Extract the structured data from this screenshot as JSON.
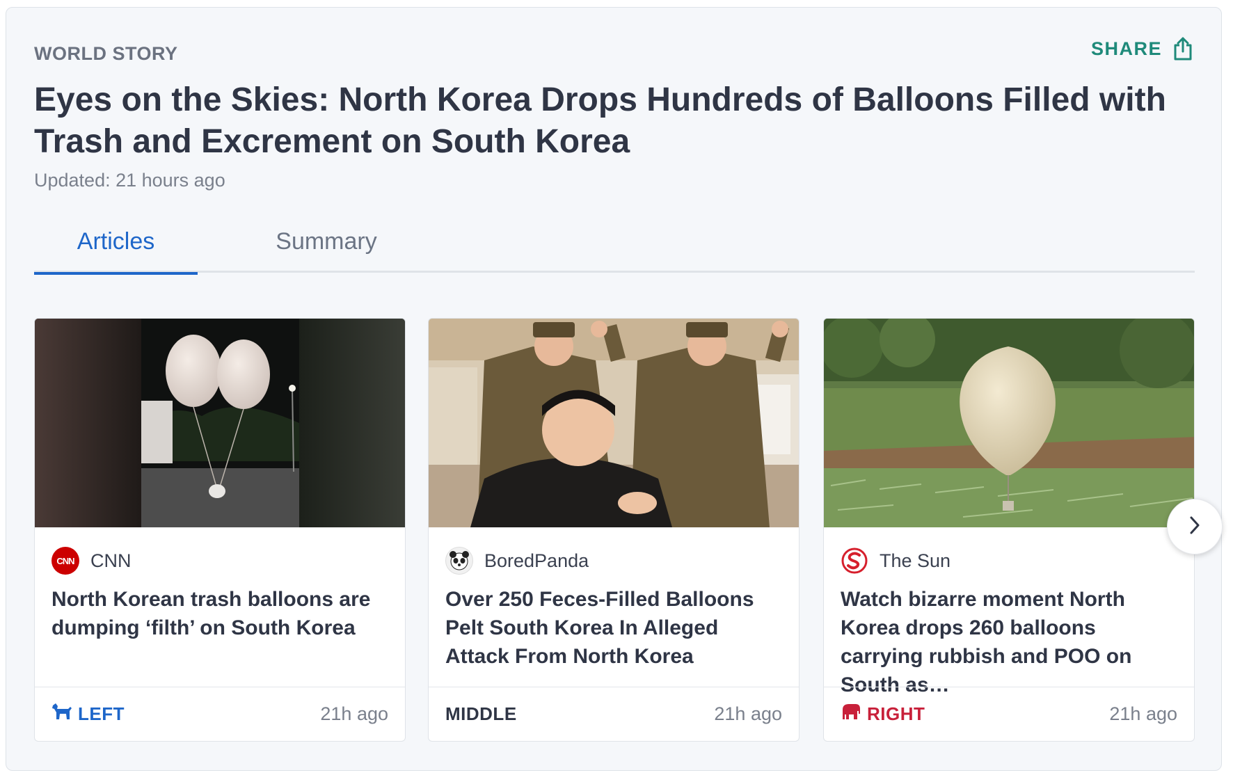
{
  "story": {
    "kicker": "WORLD STORY",
    "share_label": "SHARE",
    "headline": "Eyes on the Skies: North Korea Drops Hundreds of Balloons Filled with Trash and Excrement on South Korea",
    "updated": "Updated: 21 hours ago"
  },
  "tabs": [
    {
      "label": "Articles",
      "active": true
    },
    {
      "label": "Summary",
      "active": false
    }
  ],
  "articles": [
    {
      "source": "CNN",
      "logo_text": "CNN",
      "title": "North Korean trash balloons are dumping ‘filth’ on South Korea",
      "bias": "LEFT",
      "bias_color": "#1e66c9",
      "time": "21h ago"
    },
    {
      "source": "BoredPanda",
      "title": "Over 250 Feces-Filled Balloons Pelt South Korea In Alleged Attack From North Korea",
      "bias": "MIDDLE",
      "bias_color": "#2f3545",
      "time": "21h ago"
    },
    {
      "source": "The Sun",
      "title": "Watch bizarre moment North Korea drops 260 balloons carrying rubbish and POO on South as…",
      "bias": "RIGHT",
      "bias_color": "#c8203a",
      "time": "21h ago"
    }
  ],
  "colors": {
    "accent_blue": "#1e66c9",
    "share_teal": "#1f8a7a",
    "right_red": "#c8203a"
  },
  "icons": {
    "share": "share-icon",
    "next": "chevron-right-icon",
    "left_bias": "donkey-icon",
    "right_bias": "elephant-icon"
  }
}
